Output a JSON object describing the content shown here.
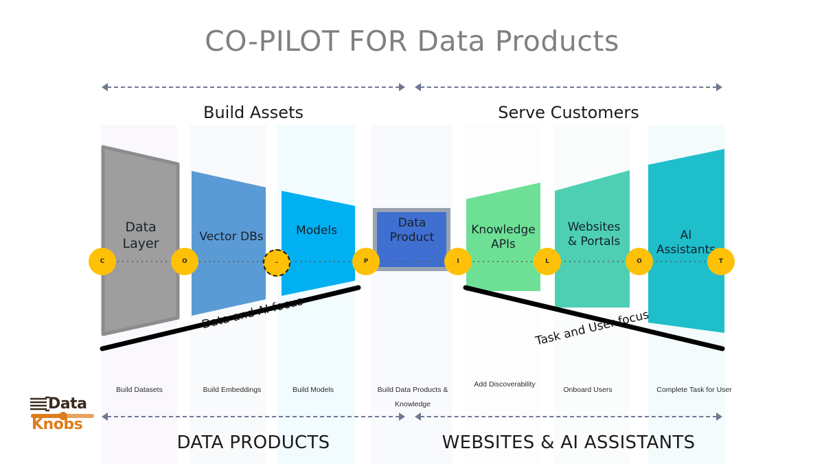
{
  "title": "CO-PILOT FOR Data Products",
  "sections": {
    "top_left": "Build Assets",
    "top_right": "Serve Customers",
    "bottom_left": "DATA PRODUCTS",
    "bottom_right": "WEBSITES & AI ASSISTANTS"
  },
  "focus_labels": {
    "left": "Data and AI focus",
    "right": "Task and User focus"
  },
  "stages": [
    {
      "label": "Data\nLayer",
      "label_l1": "Data",
      "label_l2": "Layer",
      "caption": "Build Datasets",
      "caption_l2": "",
      "color": "#9e9e9e"
    },
    {
      "label": "Vector DBs",
      "label_l1": "Vector DBs",
      "label_l2": "",
      "caption": "Build Embeddings",
      "caption_l2": "",
      "color": "#5b9bd5"
    },
    {
      "label": "Models",
      "label_l1": "Models",
      "label_l2": "",
      "caption": "Build Models",
      "caption_l2": "",
      "color": "#00b0f0"
    },
    {
      "label": "Data\nProduct",
      "label_l1": "Data",
      "label_l2": "Product",
      "caption": "Build Data Products  &",
      "caption_l2": "Knowledge",
      "color": "#3f6fd1"
    },
    {
      "label": "Knowledge\nAPIs",
      "label_l1": "Knowledge",
      "label_l2": "APIs",
      "caption": "Add Discoverability",
      "caption_l2": "",
      "color": "#6ee096"
    },
    {
      "label": "Websites\n& Portals",
      "label_l1": "Websites",
      "label_l2": "& Portals",
      "caption": "Onboard Users",
      "caption_l2": "",
      "color": "#4ecfb4"
    },
    {
      "label": "AI\nAssistants",
      "label_l1": "AI",
      "label_l2": "Assistants",
      "caption": "Complete Task for User",
      "caption_l2": "",
      "color": "#1ebecb"
    }
  ],
  "badges": [
    {
      "letter": "C",
      "dashed": false
    },
    {
      "letter": "O",
      "dashed": false
    },
    {
      "letter": "-",
      "dashed": true
    },
    {
      "letter": "P",
      "dashed": false
    },
    {
      "letter": "I",
      "dashed": false
    },
    {
      "letter": "L",
      "dashed": false
    },
    {
      "letter": "O",
      "dashed": false
    },
    {
      "letter": "T",
      "dashed": false
    }
  ],
  "logo": {
    "word1": "Data",
    "word2": "Knobs"
  },
  "colors": {
    "title": "#808080",
    "badge": "#FFC107",
    "arrow": "#6f7890",
    "rule": "#000000"
  }
}
